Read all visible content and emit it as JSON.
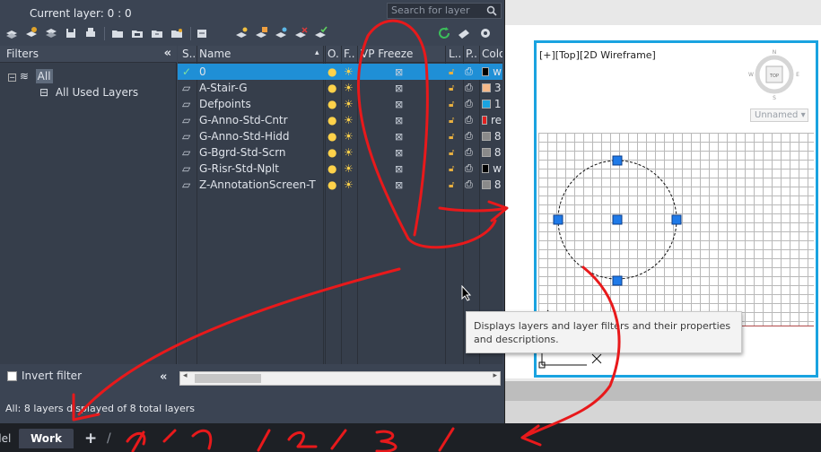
{
  "palette": {
    "current_layer": "Current layer: 0 : 0",
    "search_placeholder": "Search for layer"
  },
  "filters": {
    "title": "Filters",
    "collapse": "«",
    "root": "All",
    "child": "All Used Layers"
  },
  "grid": {
    "columns": [
      "S..",
      "Name",
      "O..",
      "F..",
      "VP Freeze",
      "L..",
      "P..",
      "Colo"
    ],
    "rows": [
      {
        "name": "0",
        "color_label": "w",
        "color": "#000000",
        "current": true,
        "selected": true
      },
      {
        "name": "A-Stair-G",
        "color_label": "3",
        "color": "#f5b98a",
        "current": false,
        "selected": false
      },
      {
        "name": "Defpoints",
        "color_label": "1",
        "color": "#1aa3e0",
        "current": false,
        "selected": false
      },
      {
        "name": "G-Anno-Std-Cntr",
        "color_label": "re",
        "color": "#e02020",
        "current": false,
        "selected": false
      },
      {
        "name": "G-Anno-Std-Hidd",
        "color_label": "8",
        "color": "#8a8a8a",
        "current": false,
        "selected": false
      },
      {
        "name": "G-Bgrd-Std-Scrn",
        "color_label": "8",
        "color": "#8a8a8a",
        "current": false,
        "selected": false
      },
      {
        "name": "G-Risr-Std-Nplt",
        "color_label": "w",
        "color": "#000000",
        "current": false,
        "selected": false
      },
      {
        "name": "Z-AnnotationScreen-T",
        "color_label": "8",
        "color": "#8a8a8a",
        "current": false,
        "selected": false
      }
    ]
  },
  "invert_filter": "Invert filter",
  "status": "All: 8 layers displayed of 8 total layers",
  "tooltip": "Displays layers and layer filters and their properties and descriptions.",
  "viewport": {
    "label": "[+][Top][2D Wireframe]",
    "viewcube_face": "TOP",
    "viewcube_n": "N",
    "viewcube_s": "S",
    "viewcube_e": "E",
    "viewcube_w": "W",
    "named_view": "Unnamed"
  },
  "tabs": {
    "model": "del",
    "work": "Work",
    "add": "+",
    "slash": "/"
  }
}
